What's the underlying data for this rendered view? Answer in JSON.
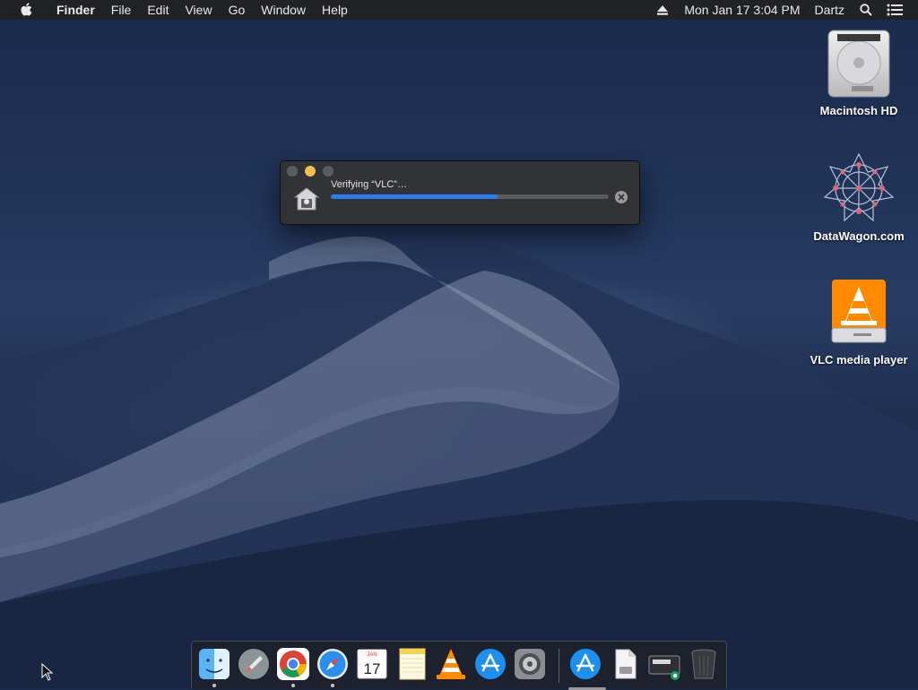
{
  "menubar": {
    "app_name": "Finder",
    "items": [
      "File",
      "Edit",
      "View",
      "Go",
      "Window",
      "Help"
    ],
    "datetime": "Mon Jan 17  3:04 PM",
    "user": "Dartz"
  },
  "desktop_icons": [
    {
      "label": "Macintosh HD",
      "icon": "hard-drive-icon"
    },
    {
      "label": "DataWagon.com",
      "icon": "datawagon-logo-icon"
    },
    {
      "label": "VLC media player",
      "icon": "vlc-disk-image-icon"
    }
  ],
  "progress_window": {
    "title": "Verifying “VLC”…",
    "progress": 0.6,
    "icon": "house-lock-icon"
  },
  "dock": {
    "apps": [
      {
        "name": "Finder",
        "icon": "finder-icon",
        "running": true
      },
      {
        "name": "Launchpad",
        "icon": "launchpad-icon",
        "running": false
      },
      {
        "name": "Google Chrome",
        "icon": "chrome-icon",
        "running": true
      },
      {
        "name": "Safari",
        "icon": "safari-icon",
        "running": true
      },
      {
        "name": "Calendar",
        "icon": "calendar-icon",
        "running": false,
        "month": "JAN",
        "day": "17"
      },
      {
        "name": "Notes",
        "icon": "notes-icon",
        "running": false
      },
      {
        "name": "VLC",
        "icon": "vlc-icon",
        "running": false
      },
      {
        "name": "App Store",
        "icon": "app-store-icon",
        "running": false
      },
      {
        "name": "System Preferences",
        "icon": "system-preferences-icon",
        "running": false
      },
      {
        "name": "App Store Downloads",
        "icon": "app-store-folder-icon",
        "running": false
      },
      {
        "name": "Document",
        "icon": "document-icon",
        "running": false
      },
      {
        "name": "Disk Image",
        "icon": "disk-image-icon",
        "running": false
      },
      {
        "name": "Trash",
        "icon": "trash-icon",
        "running": false
      }
    ]
  },
  "colors": {
    "menubar_bg": "#202226",
    "progress_fill": "#2f7bf0",
    "minimize_button": "#f4bf4f"
  }
}
